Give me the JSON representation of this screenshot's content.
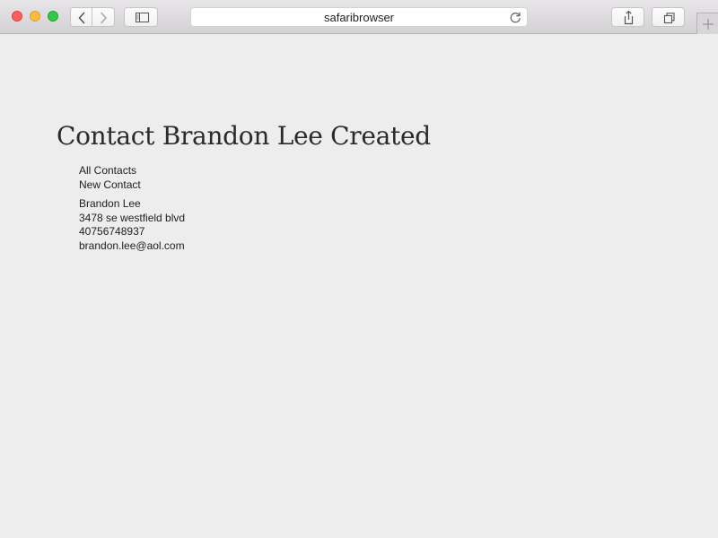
{
  "browser": {
    "address_text": "safaribrowser"
  },
  "page": {
    "title": "Contact Brandon Lee Created",
    "nav_links": [
      "All Contacts",
      "New Contact"
    ],
    "contact": {
      "name": "Brandon Lee",
      "address": "3478 se westfield blvd",
      "phone": "40756748937",
      "email": "brandon.lee@aol.com"
    }
  },
  "colors": {
    "close": "#fc605c",
    "minimize": "#fdbc40",
    "zoom": "#34c84a",
    "page_background": "#eeedee"
  },
  "icons": {
    "back": "chevron-left-icon",
    "forward": "chevron-right-icon",
    "sidebar": "sidebar-icon",
    "reload": "reload-icon",
    "share": "share-icon",
    "tabs": "tabs-icon",
    "new_tab": "plus-icon"
  }
}
